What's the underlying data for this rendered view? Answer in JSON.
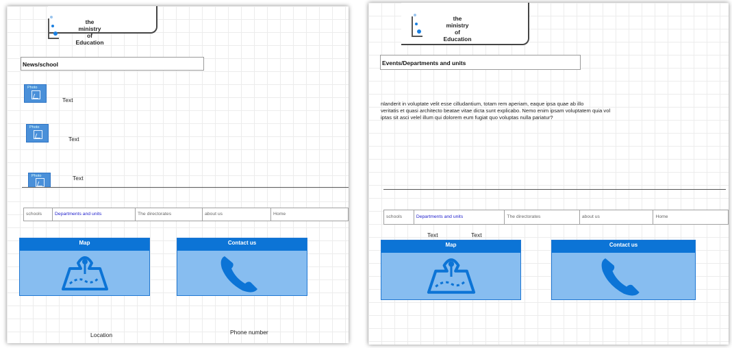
{
  "left_page": {
    "logo": {
      "line1": "the",
      "line2": "ministry",
      "line3": "of",
      "line4": "Education"
    },
    "title": "News/school",
    "news_items": [
      {
        "photo_label": "Photo",
        "text": "Text"
      },
      {
        "photo_label": "Photo",
        "text": "Text"
      },
      {
        "photo_label": "Photo",
        "text": "Text"
      }
    ],
    "nav": [
      "schools",
      "Departments and units",
      "The directorates",
      "about us",
      "Home"
    ],
    "cards": {
      "map_title": "Map",
      "contact_title": "Contact us"
    },
    "footer": {
      "location": "Location",
      "phone": "Phone number"
    }
  },
  "right_page": {
    "logo": {
      "line1": "the",
      "line2": "ministry",
      "line3": "of",
      "line4": "Education"
    },
    "title": "Events/Departments and units",
    "paragraph": [
      "nlanderit in voluptate velit esse cilludantium, totam rem aperiam, eaque ipsa quae ab illo",
      "veritatis et quasi architecto beatae vitae dicta sunt explicabo. Nemo enim ipsam voluptatem quia vol",
      "iptas sit asci velel illum qui dolorem eum fugiat quo voluptas nulla pariatur?"
    ],
    "nav": [
      "schools",
      "Departments and units",
      "The directorates",
      "about us",
      "Home"
    ],
    "under_nav": {
      "text1": "Text",
      "text2": "Text"
    },
    "cards": {
      "map_title": "Map",
      "contact_title": "Contact us"
    }
  },
  "colors": {
    "accent": "#0c74d6",
    "card_fill": "#87bdf0",
    "icon": "#0c74d6",
    "link": "#2222cc"
  },
  "icons": {
    "map": "map-pin-icon",
    "contact": "phone-icon",
    "photo": "photo-icon"
  }
}
